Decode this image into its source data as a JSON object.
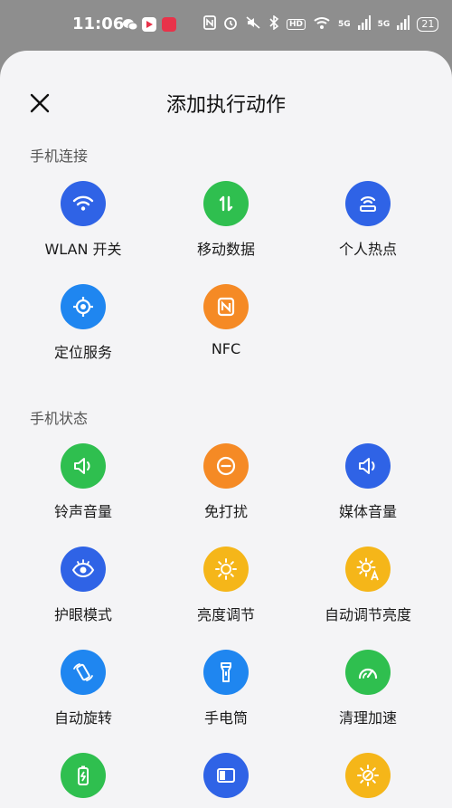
{
  "status_bar": {
    "time": "11:06",
    "network_badge_1": "5G",
    "network_badge_2": "5G",
    "hd_badge": "HD",
    "battery": "21"
  },
  "header": {
    "title": "添加执行动作"
  },
  "sections": [
    {
      "title": "手机连接",
      "items": [
        {
          "label": "WLAN 开关",
          "icon": "wifi-icon",
          "color": "#2f63e6"
        },
        {
          "label": "移动数据",
          "icon": "mobile-data-icon",
          "color": "#2fbf4f"
        },
        {
          "label": "个人热点",
          "icon": "hotspot-icon",
          "color": "#2f63e6"
        },
        {
          "label": "定位服务",
          "icon": "location-icon",
          "color": "#1f86f0"
        },
        {
          "label": "NFC",
          "icon": "nfc-icon",
          "color": "#f58a25"
        }
      ]
    },
    {
      "title": "手机状态",
      "items": [
        {
          "label": "铃声音量",
          "icon": "ring-volume-icon",
          "color": "#2fbf4f"
        },
        {
          "label": "免打扰",
          "icon": "do-not-disturb-icon",
          "color": "#f58a25"
        },
        {
          "label": "媒体音量",
          "icon": "media-volume-icon",
          "color": "#2f63e6"
        },
        {
          "label": "护眼模式",
          "icon": "eye-icon",
          "color": "#2f63e6"
        },
        {
          "label": "亮度调节",
          "icon": "brightness-icon",
          "color": "#f5b619"
        },
        {
          "label": "自动调节亮度",
          "icon": "auto-brightness-icon",
          "color": "#f5b619"
        },
        {
          "label": "自动旋转",
          "icon": "auto-rotate-icon",
          "color": "#1f86f0"
        },
        {
          "label": "手电筒",
          "icon": "flashlight-icon",
          "color": "#1f86f0"
        },
        {
          "label": "清理加速",
          "icon": "speed-up-icon",
          "color": "#2fbf4f"
        },
        {
          "label": "",
          "icon": "battery-saver-icon",
          "color": "#2fbf4f"
        },
        {
          "label": "",
          "icon": "split-screen-icon",
          "color": "#2f63e6"
        },
        {
          "label": "",
          "icon": "sun-settings-icon",
          "color": "#f5b619"
        }
      ]
    }
  ]
}
